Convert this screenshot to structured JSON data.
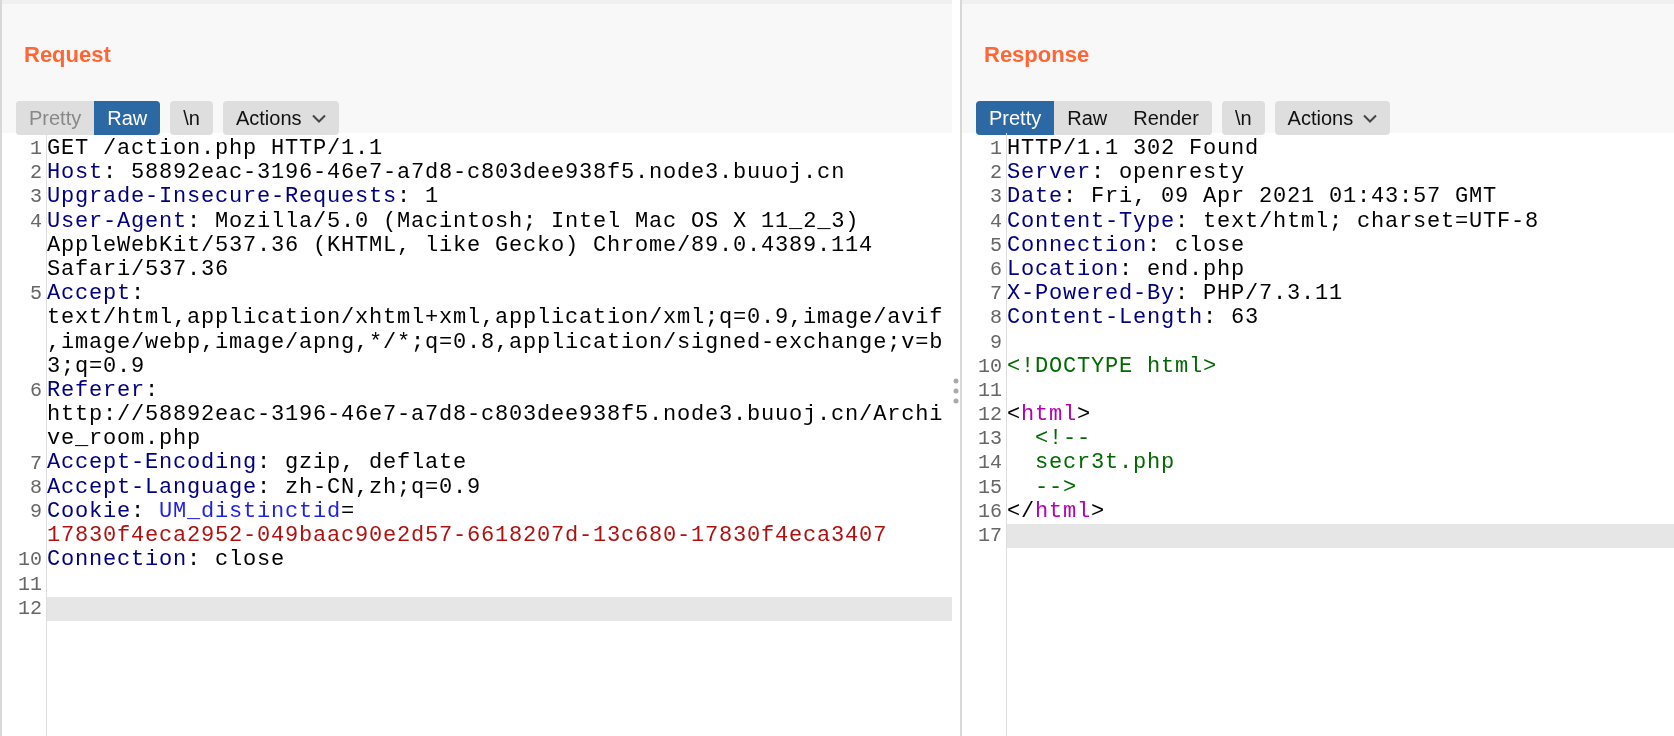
{
  "panels": [
    {
      "title": "Request",
      "view_tabs": [
        {
          "label": "Pretty",
          "selected": false
        },
        {
          "label": "Raw",
          "selected": true
        }
      ],
      "newline_button": "\\n",
      "actions_button": "Actions",
      "lines": [
        {
          "number": "1",
          "current": false,
          "rows": [
            [
              {
                "text": "GET /action.php HTTP/1.1",
                "kind": "plain"
              }
            ]
          ]
        },
        {
          "number": "2",
          "current": false,
          "rows": [
            [
              {
                "text": "Host",
                "kind": "header"
              },
              {
                "text": ": 58892eac-3196-46e7-a7d8-c803dee938f5.node3.buuoj.cn",
                "kind": "plain"
              }
            ]
          ]
        },
        {
          "number": "3",
          "current": false,
          "rows": [
            [
              {
                "text": "Upgrade-Insecure-Requests",
                "kind": "header"
              },
              {
                "text": ": 1",
                "kind": "plain"
              }
            ]
          ]
        },
        {
          "number": "4",
          "current": false,
          "rows": [
            [
              {
                "text": "User-Agent",
                "kind": "header"
              },
              {
                "text": ": Mozilla/5.0 (Macintosh; Intel Mac OS X 11_2_3)",
                "kind": "plain"
              }
            ],
            [
              {
                "text": "AppleWebKit/537.36 (KHTML, like Gecko) Chrome/89.0.4389.114",
                "kind": "plain"
              }
            ],
            [
              {
                "text": "Safari/537.36",
                "kind": "plain"
              }
            ]
          ]
        },
        {
          "number": "5",
          "current": false,
          "rows": [
            [
              {
                "text": "Accept",
                "kind": "header"
              },
              {
                "text": ":",
                "kind": "plain"
              }
            ],
            [
              {
                "text": "text/html,application/xhtml+xml,application/xml;q=0.9,image/avif",
                "kind": "plain"
              }
            ],
            [
              {
                "text": ",image/webp,image/apng,*/*;q=0.8,application/signed-exchange;v=b",
                "kind": "plain"
              }
            ],
            [
              {
                "text": "3;q=0.9",
                "kind": "plain"
              }
            ]
          ]
        },
        {
          "number": "6",
          "current": false,
          "rows": [
            [
              {
                "text": "Referer",
                "kind": "header"
              },
              {
                "text": ":",
                "kind": "plain"
              }
            ],
            [
              {
                "text": "http://58892eac-3196-46e7-a7d8-c803dee938f5.node3.buuoj.cn/Archi",
                "kind": "plain"
              }
            ],
            [
              {
                "text": "ve_room.php",
                "kind": "plain"
              }
            ]
          ]
        },
        {
          "number": "7",
          "current": false,
          "rows": [
            [
              {
                "text": "Accept-Encoding",
                "kind": "header"
              },
              {
                "text": ": gzip, deflate",
                "kind": "plain"
              }
            ]
          ]
        },
        {
          "number": "8",
          "current": false,
          "rows": [
            [
              {
                "text": "Accept-Language",
                "kind": "header"
              },
              {
                "text": ": zh-CN,zh;q=0.9",
                "kind": "plain"
              }
            ]
          ]
        },
        {
          "number": "9",
          "current": false,
          "rows": [
            [
              {
                "text": "Cookie",
                "kind": "header"
              },
              {
                "text": ": ",
                "kind": "plain"
              },
              {
                "text": "UM_distinctid",
                "kind": "param-name"
              },
              {
                "text": "=",
                "kind": "plain"
              }
            ],
            [
              {
                "text": "17830f4eca2952-049baac90e2d57-6618207d-13c680-17830f4eca3407",
                "kind": "param-value"
              }
            ]
          ]
        },
        {
          "number": "10",
          "current": false,
          "rows": [
            [
              {
                "text": "Connection",
                "kind": "header"
              },
              {
                "text": ": close",
                "kind": "plain"
              }
            ]
          ]
        },
        {
          "number": "11",
          "current": false,
          "rows": [
            []
          ]
        },
        {
          "number": "12",
          "current": true,
          "rows": [
            []
          ]
        }
      ]
    },
    {
      "title": "Response",
      "view_tabs": [
        {
          "label": "Pretty",
          "selected": true
        },
        {
          "label": "Raw",
          "selected": false
        },
        {
          "label": "Render",
          "selected": false
        }
      ],
      "newline_button": "\\n",
      "actions_button": "Actions",
      "lines": [
        {
          "number": "1",
          "current": false,
          "rows": [
            [
              {
                "text": "HTTP/1.1 302 Found",
                "kind": "plain"
              }
            ]
          ]
        },
        {
          "number": "2",
          "current": false,
          "rows": [
            [
              {
                "text": "Server",
                "kind": "header"
              },
              {
                "text": ": openresty",
                "kind": "plain"
              }
            ]
          ]
        },
        {
          "number": "3",
          "current": false,
          "rows": [
            [
              {
                "text": "Date",
                "kind": "header"
              },
              {
                "text": ": Fri, 09 Apr 2021 01:43:57 GMT",
                "kind": "plain"
              }
            ]
          ]
        },
        {
          "number": "4",
          "current": false,
          "rows": [
            [
              {
                "text": "Content-Type",
                "kind": "header"
              },
              {
                "text": ": text/html; charset=UTF-8",
                "kind": "plain"
              }
            ]
          ]
        },
        {
          "number": "5",
          "current": false,
          "rows": [
            [
              {
                "text": "Connection",
                "kind": "header"
              },
              {
                "text": ": close",
                "kind": "plain"
              }
            ]
          ]
        },
        {
          "number": "6",
          "current": false,
          "rows": [
            [
              {
                "text": "Location",
                "kind": "header"
              },
              {
                "text": ": end.php",
                "kind": "plain"
              }
            ]
          ]
        },
        {
          "number": "7",
          "current": false,
          "rows": [
            [
              {
                "text": "X-Powered-By",
                "kind": "header"
              },
              {
                "text": ": PHP/7.3.11",
                "kind": "plain"
              }
            ]
          ]
        },
        {
          "number": "8",
          "current": false,
          "rows": [
            [
              {
                "text": "Content-Length",
                "kind": "header"
              },
              {
                "text": ": 63",
                "kind": "plain"
              }
            ]
          ]
        },
        {
          "number": "9",
          "current": false,
          "rows": [
            []
          ]
        },
        {
          "number": "10",
          "current": false,
          "rows": [
            [
              {
                "text": "<!DOCTYPE html>",
                "kind": "comment"
              }
            ]
          ]
        },
        {
          "number": "11",
          "current": false,
          "rows": [
            []
          ]
        },
        {
          "number": "12",
          "current": false,
          "rows": [
            [
              {
                "text": "<",
                "kind": "plain"
              },
              {
                "text": "html",
                "kind": "tag"
              },
              {
                "text": ">",
                "kind": "plain"
              }
            ]
          ]
        },
        {
          "number": "13",
          "current": false,
          "rows": [
            [
              {
                "text": "  <!--",
                "kind": "comment"
              }
            ]
          ]
        },
        {
          "number": "14",
          "current": false,
          "rows": [
            [
              {
                "text": "  secr3t.php",
                "kind": "comment"
              }
            ]
          ]
        },
        {
          "number": "15",
          "current": false,
          "rows": [
            [
              {
                "text": "  -->",
                "kind": "comment"
              }
            ]
          ]
        },
        {
          "number": "16",
          "current": false,
          "rows": [
            [
              {
                "text": "</",
                "kind": "plain"
              },
              {
                "text": "html",
                "kind": "tag"
              },
              {
                "text": ">",
                "kind": "plain"
              }
            ]
          ]
        },
        {
          "number": "17",
          "current": true,
          "rows": [
            []
          ]
        }
      ]
    }
  ]
}
